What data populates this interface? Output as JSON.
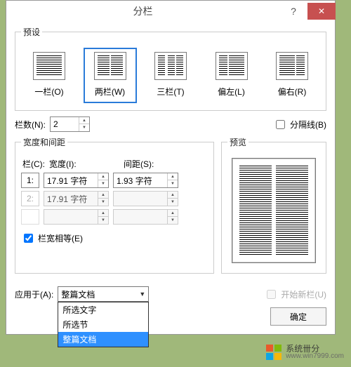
{
  "dialog": {
    "title": "分栏",
    "help": "?",
    "close": "✕"
  },
  "presets": {
    "legend": "预设",
    "items": [
      {
        "label": "一栏(O)",
        "type": "one",
        "selected": false
      },
      {
        "label": "两栏(W)",
        "type": "two",
        "selected": true
      },
      {
        "label": "三栏(T)",
        "type": "three",
        "selected": false
      },
      {
        "label": "偏左(L)",
        "type": "left",
        "selected": false
      },
      {
        "label": "偏右(R)",
        "type": "right",
        "selected": false
      }
    ]
  },
  "col_count": {
    "label": "栏数(N):",
    "value": "2"
  },
  "separator": {
    "label": "分隔线(B)",
    "checked": false
  },
  "width_spacing": {
    "legend": "宽度和间距",
    "headers": {
      "col": "栏(C):",
      "width": "宽度(I):",
      "spacing": "间距(S):"
    },
    "rows": [
      {
        "num": "1:",
        "width": "17.91 字符",
        "spacing": "1.93 字符",
        "enabled": true
      },
      {
        "num": "2:",
        "width": "17.91 字符",
        "spacing": "",
        "enabled": false
      }
    ],
    "equal": {
      "label": "栏宽相等(E)",
      "checked": true
    }
  },
  "preview": {
    "legend": "预览"
  },
  "apply_to": {
    "label": "应用于(A):",
    "value": "整篇文档",
    "open": true,
    "options": [
      "所选文字",
      "所选节",
      "整篇文档"
    ],
    "selected_index": 2
  },
  "start_new": {
    "label": "开始新栏(U)",
    "enabled": false
  },
  "buttons": {
    "ok": "确定"
  },
  "watermark": {
    "name": "系统卌分",
    "site": "www.win7999.com"
  }
}
